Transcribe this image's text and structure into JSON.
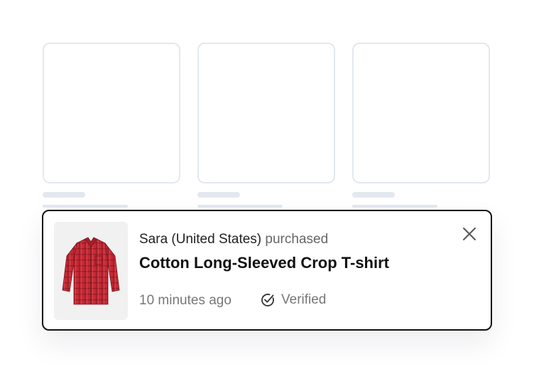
{
  "toast": {
    "buyer": "Sara (United States)",
    "verb": "purchased",
    "product": "Cotton Long-Sleeved Crop T-shirt",
    "time_ago": "10 minutes ago",
    "verified_label": "Verified"
  },
  "icons": {
    "close": "close-icon",
    "verified": "check-circle-icon",
    "product_image": "red-plaid-shirt-image"
  },
  "colors": {
    "toast_border": "#111111",
    "placeholder": "#e3e8f0",
    "muted_text": "#777777",
    "shirt_red": "#c62a35"
  }
}
